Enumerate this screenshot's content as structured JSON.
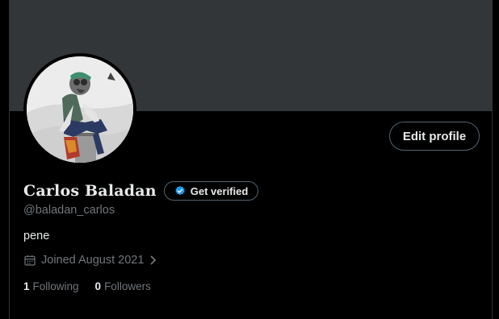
{
  "profile": {
    "display_name": "Carlos Baladan",
    "handle": "@baladan_carlos",
    "bio": "pene",
    "joined": "Joined August 2021",
    "get_verified_label": "Get verified",
    "edit_profile_label": "Edit profile",
    "following_count": "1",
    "following_label": "Following",
    "followers_count": "0",
    "followers_label": "Followers"
  },
  "icons": {
    "verified": "verified-badge-icon",
    "calendar": "calendar-icon",
    "chevron": "chevron-right-icon"
  },
  "colors": {
    "background": "#000000",
    "banner": "#333639",
    "text_primary": "#e7e9ea",
    "text_secondary": "#71767b",
    "border": "#536471",
    "verified_blue": "#1d9bf0"
  }
}
